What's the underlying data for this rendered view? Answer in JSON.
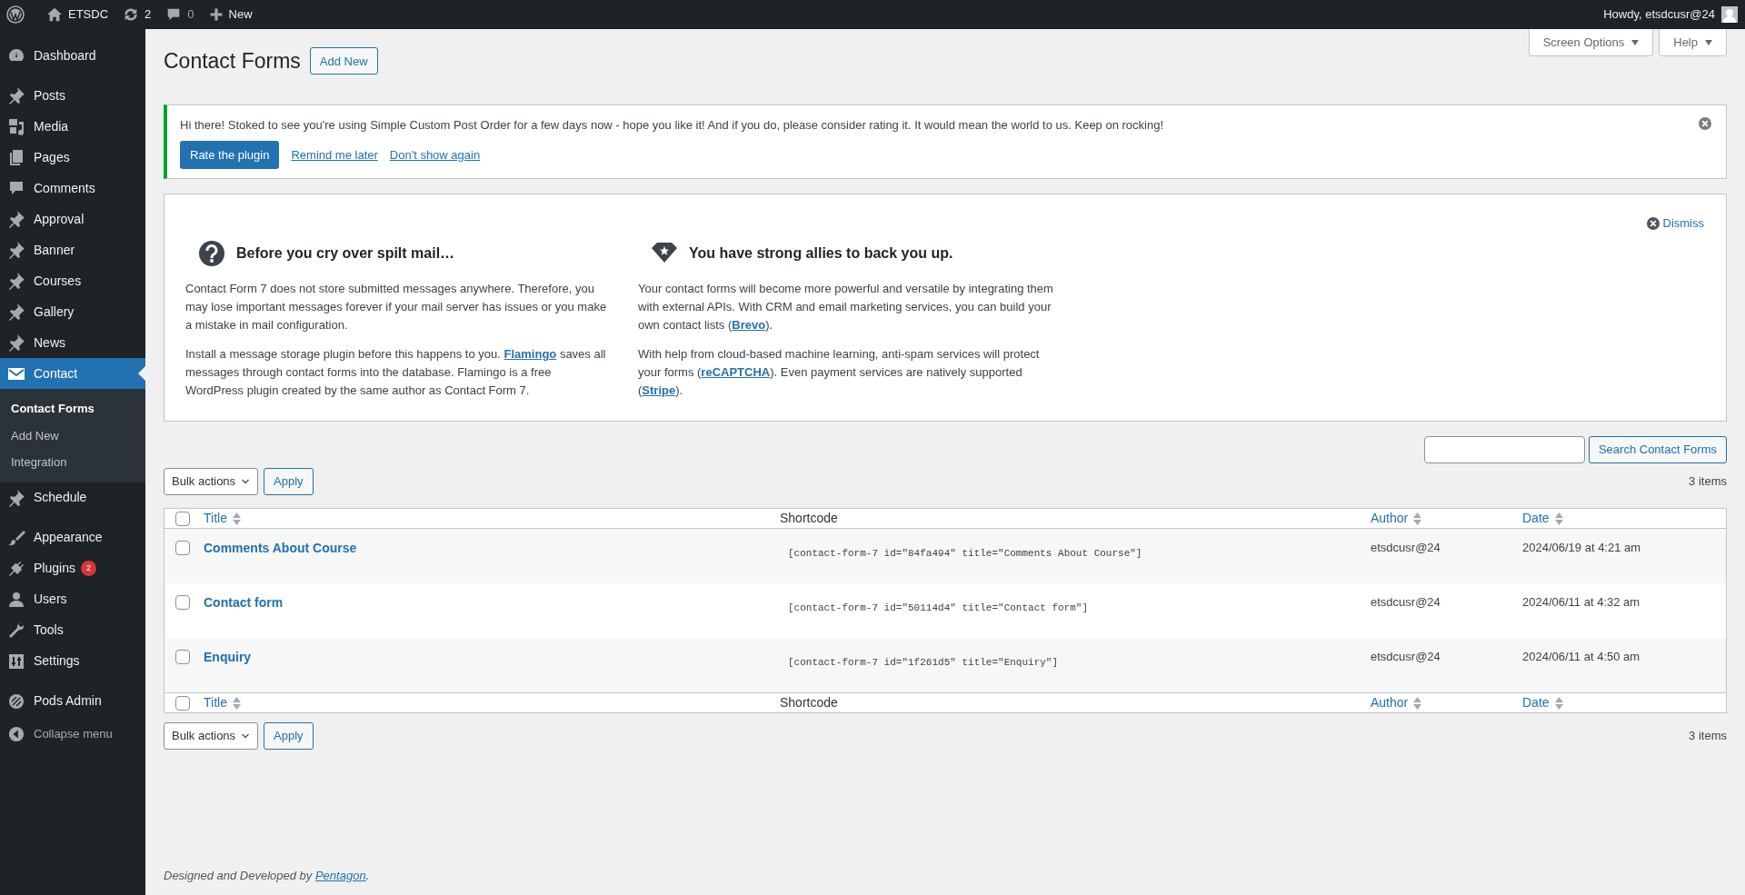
{
  "admin_bar": {
    "site": "ETSDC",
    "updates": "2",
    "comments": "0",
    "new": "New",
    "greeting": "Howdy, etsdcusr@24"
  },
  "sidebar": {
    "groups": [
      [
        {
          "label": "Dashboard",
          "selected": false
        }
      ],
      [
        {
          "label": "Posts",
          "selected": false
        },
        {
          "label": "Media",
          "selected": false
        },
        {
          "label": "Pages",
          "selected": false
        },
        {
          "label": "Comments",
          "selected": false
        },
        {
          "label": "Approval",
          "selected": false
        },
        {
          "label": "Banner",
          "selected": false
        },
        {
          "label": "Courses",
          "selected": false
        },
        {
          "label": "Gallery",
          "selected": false
        },
        {
          "label": "News",
          "selected": false
        },
        {
          "label": "Contact",
          "selected": true,
          "children": [
            {
              "label": "Contact Forms",
              "selected": true
            },
            {
              "label": "Add New",
              "selected": false
            },
            {
              "label": "Integration",
              "selected": false
            }
          ]
        },
        {
          "label": "Schedule",
          "selected": false
        }
      ],
      [
        {
          "label": "Appearance",
          "selected": false
        },
        {
          "label": "Plugins",
          "selected": false,
          "badge": "2"
        },
        {
          "label": "Users",
          "selected": false
        },
        {
          "label": "Tools",
          "selected": false
        },
        {
          "label": "Settings",
          "selected": false
        }
      ],
      [
        {
          "label": "Pods Admin",
          "selected": false
        }
      ]
    ],
    "collapse": "Collapse menu"
  },
  "screen_tabs": [
    "Screen Options",
    "Help"
  ],
  "page_title": "Contact Forms",
  "add_new": "Add New",
  "notice": {
    "text": "Hi there! Stoked to see you're using Simple Custom Post Order for a few days now - hope you like it! And if you do, please consider rating it. It would mean the world to us. Keep on rocking!",
    "primary": "Rate the plugin",
    "links": [
      "Remind me later",
      "Don't show again"
    ]
  },
  "welcome_panel": {
    "dismiss": "Dismiss",
    "columns": [
      {
        "heading": "Before you cry over spilt mail…",
        "paragraphs": [
          "Contact Form 7 does not store submitted messages anywhere. Therefore, you may lose important messages forever if your mail server has issues or you make a mistake in mail configuration.",
          "Install a message storage plugin before this happens to you. **Flamingo** saves all messages through contact forms into the database. Flamingo is a free WordPress plugin created by the same author as Contact Form 7."
        ]
      },
      {
        "heading": "You have strong allies to back you up.",
        "paragraphs": [
          "Your contact forms will become more powerful and versatile by integrating them with external APIs. With CRM and email marketing services, you can build your own contact lists (**Brevo**).",
          "With help from cloud-based machine learning, anti-spam services will protect your forms (**reCAPTCHA**). Even payment services are natively supported (**Stripe**)."
        ]
      }
    ]
  },
  "search": {
    "button": "Search Contact Forms"
  },
  "tablenav_top": {
    "bulk": "Bulk actions",
    "apply": "Apply",
    "count": "3 items"
  },
  "table": {
    "select_all_checked": false,
    "columns": [
      {
        "label": "Title",
        "sortable": true
      },
      {
        "label": "Shortcode",
        "sortable": false
      },
      {
        "label": "Author",
        "sortable": true
      },
      {
        "label": "Date",
        "sortable": true
      }
    ],
    "rows": [
      {
        "checked": false,
        "title": "Comments About Course",
        "shortcode": "[contact-form-7 id=\"84fa494\" title=\"Comments About Course\"]",
        "author": "etsdcusr@24",
        "date": "2024/06/19 at 4:21 am"
      },
      {
        "checked": false,
        "title": "Contact form",
        "shortcode": "[contact-form-7 id=\"50114d4\" title=\"Contact form\"]",
        "author": "etsdcusr@24",
        "date": "2024/06/11 at 4:32 am"
      },
      {
        "checked": false,
        "title": "Enquiry",
        "shortcode": "[contact-form-7 id=\"1f261d5\" title=\"Enquiry\"]",
        "author": "etsdcusr@24",
        "date": "2024/06/11 at 4:50 am"
      }
    ]
  },
  "footer_columns": [
    {
      "label": "Title",
      "sortable": true
    },
    {
      "label": "Shortcode",
      "sortable": false
    },
    {
      "label": "Author",
      "sortable": true
    },
    {
      "label": "Date",
      "sortable": true
    }
  ],
  "tablenav_bottom": {
    "bulk": "Bulk actions",
    "apply": "Apply",
    "count": "3 items"
  },
  "footer": {
    "prefix": "Designed and Developed by ",
    "link": "Pentagon",
    "suffix": "."
  }
}
